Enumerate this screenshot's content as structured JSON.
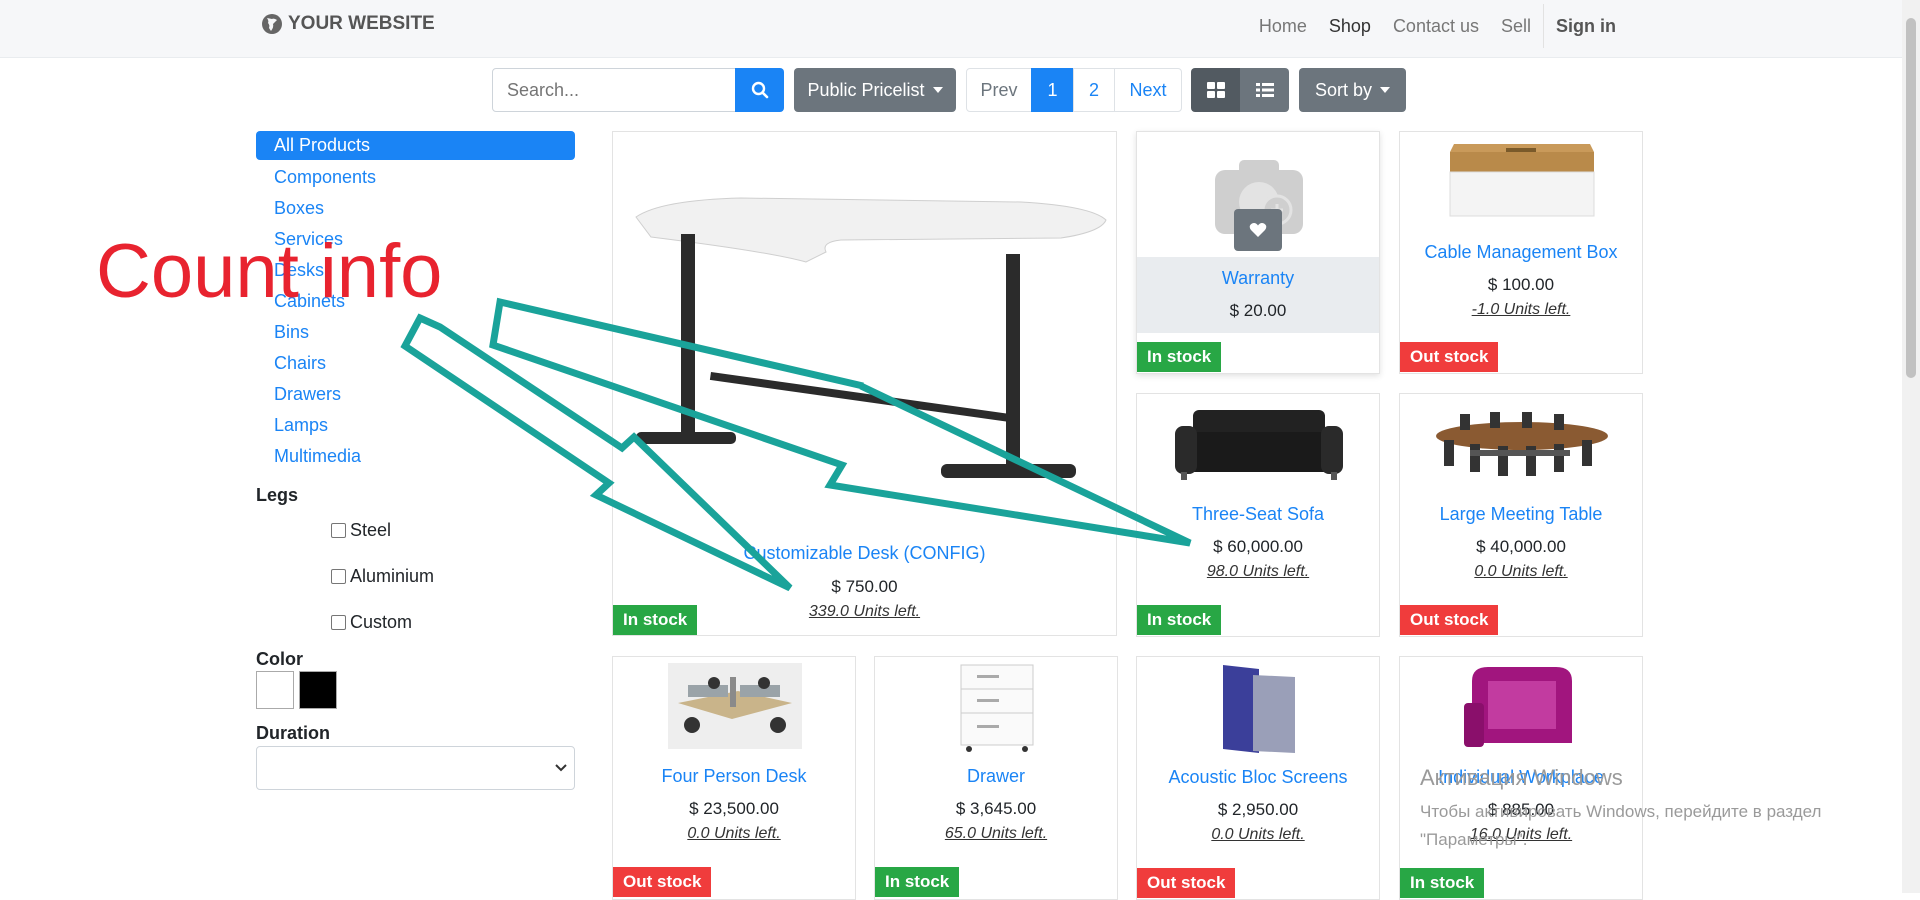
{
  "header": {
    "brand": "YOUR WEBSITE",
    "nav": [
      "Home",
      "Shop",
      "Contact us",
      "Sell"
    ],
    "sign_in": "Sign in"
  },
  "toolbar": {
    "search_placeholder": "Search...",
    "pricelist_label": "Public Pricelist",
    "pager": {
      "prev": "Prev",
      "pages": [
        "1",
        "2"
      ],
      "next": "Next",
      "current": "1"
    },
    "sort_label": "Sort by"
  },
  "sidebar": {
    "categories": [
      "All Products",
      "Components",
      "Boxes",
      "Services",
      "Desks",
      "Cabinets",
      "Bins",
      "Chairs",
      "Drawers",
      "Lamps",
      "Multimedia"
    ],
    "legs_title": "Legs",
    "legs": [
      "Steel",
      "Aluminium",
      "Custom"
    ],
    "color_title": "Color",
    "colors": [
      "#ffffff",
      "#000000"
    ],
    "duration_title": "Duration",
    "duration_value": ""
  },
  "products": [
    {
      "name": "Customizable Desk (CONFIG)",
      "price": "$ 750.00",
      "units": "339.0 Units left.",
      "stock": "In stock"
    },
    {
      "name": "Warranty",
      "price": "$ 20.00",
      "units": "",
      "stock": "In stock"
    },
    {
      "name": "Cable Management Box",
      "price": "$ 100.00",
      "units": "-1.0 Units left.",
      "stock": "Out stock"
    },
    {
      "name": "Three-Seat Sofa",
      "price": "$ 60,000.00",
      "units": "98.0 Units left.",
      "stock": "In stock"
    },
    {
      "name": "Large Meeting Table",
      "price": "$ 40,000.00",
      "units": "0.0 Units left.",
      "stock": "Out stock"
    },
    {
      "name": "Four Person Desk",
      "price": "$ 23,500.00",
      "units": "0.0 Units left.",
      "stock": "Out stock"
    },
    {
      "name": "Drawer",
      "price": "$ 3,645.00",
      "units": "65.0 Units left.",
      "stock": "In stock"
    },
    {
      "name": "Acoustic Bloc Screens",
      "price": "$ 2,950.00",
      "units": "0.0 Units left.",
      "stock": "Out stock"
    },
    {
      "name": "Individual Workplace",
      "price": "$ 885.00",
      "units": "16.0 Units left.",
      "stock": "In stock"
    }
  ],
  "annotation": {
    "text": "Count info",
    "color": "#e8232f",
    "arrow_color": "#1aa39a"
  },
  "watermark": {
    "title": "Активация Windows",
    "body": "Чтобы активировать Windows, перейдите в раздел \"Параметры\"."
  },
  "colors": {
    "primary": "#1a84f5",
    "in_stock": "#28a745",
    "out_stock": "#f03c3c",
    "secondary": "#6c757d"
  }
}
